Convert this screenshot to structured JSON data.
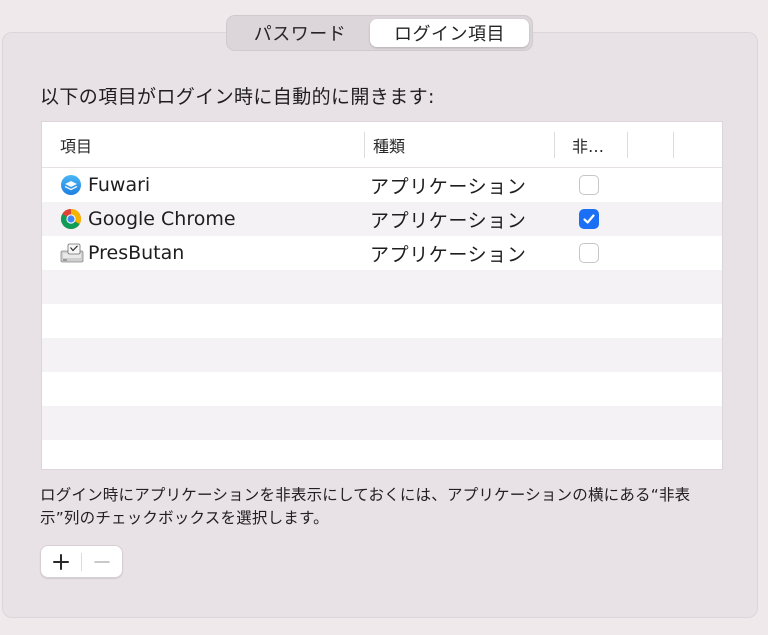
{
  "tabs": [
    {
      "label": "パスワード",
      "active": false
    },
    {
      "label": "ログイン項目",
      "active": true
    }
  ],
  "heading": "以下の項目がログイン時に自動的に開きます:",
  "table": {
    "columns": {
      "item": "項目",
      "kind": "種類",
      "hide": "非…"
    },
    "rows": [
      {
        "name": "Fuwari",
        "kind": "アプリケーション",
        "hidden": false,
        "icon": "fuwari-app-icon"
      },
      {
        "name": "Google Chrome",
        "kind": "アプリケーション",
        "hidden": true,
        "icon": "chrome-app-icon"
      },
      {
        "name": "PresButan",
        "kind": "アプリケーション",
        "hidden": false,
        "icon": "presbutan-app-icon"
      }
    ]
  },
  "note": "ログイン時にアプリケーションを非表示にしておくには、アプリケーションの横にある“非表示”列のチェックボックスを選択します。",
  "buttons": {
    "add": "+",
    "remove": "−"
  },
  "colors": {
    "accent": "#1a6ff5",
    "window_bg": "#efe9ec",
    "panel_bg": "#e8e2e6"
  }
}
